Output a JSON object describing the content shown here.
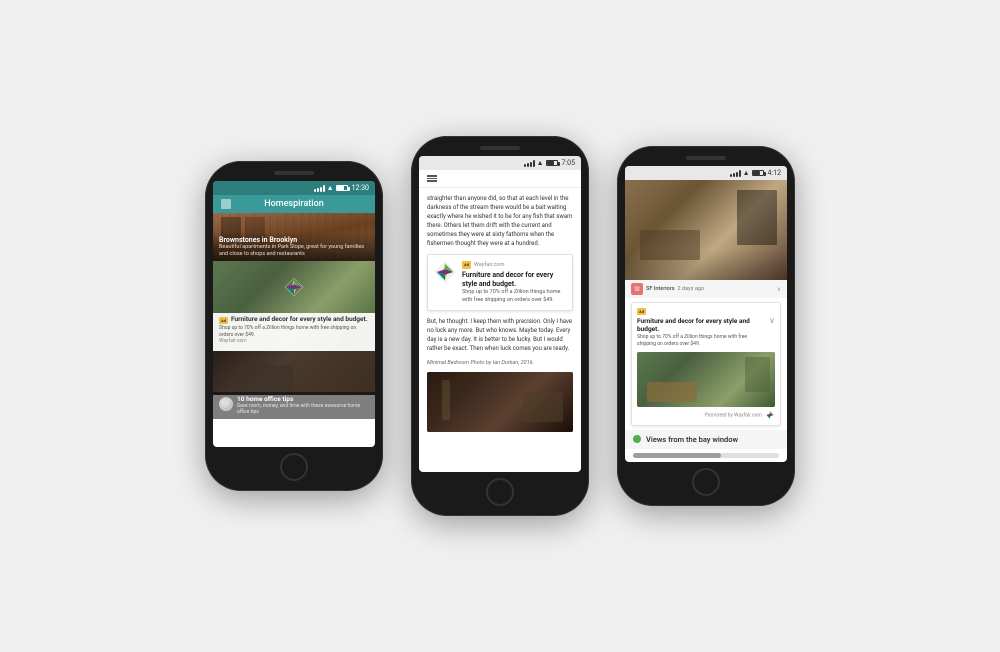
{
  "bg_color": "#f0f0f0",
  "phone1": {
    "status": {
      "time": "12:30",
      "carrier": ""
    },
    "header": {
      "title": "Homespiration",
      "home_icon": "🏠"
    },
    "card1": {
      "title": "Brownstones in Brooklyn",
      "subtitle": "Beautiful apartments in Park Slope, great for young families and close to shops and restaurants"
    },
    "card2": {
      "ad_label": "Ad",
      "source": "Wayfair.com",
      "title": "Furniture and decor for every style and budget.",
      "subtitle": "Shop up to 70% off a Zillion things home with free shipping on orders over $49."
    },
    "card3": {
      "title": "10 home office tips",
      "subtitle": "Save room, money, and time with these awesome home office tips"
    }
  },
  "phone2": {
    "status": {
      "time": "7:05"
    },
    "article_text": "straighter than anyone did, so that at each level in the darkness of the stream there would be a bait waiting exactly where he wished it to be for any fish that swam there. Others let them drift with the current and sometimes they were at sixty fathoms when the fishermen thought they were at a hundred.",
    "ad": {
      "ad_label": "Ad",
      "source": "Wayfair.com",
      "title": "Furniture and decor for every style and budget.",
      "subtitle": "Shop up to 70% off a Zillion things home with free shipping on orders over $49."
    },
    "article_text2": "But, he thought. I keep them with precision. Only I have no luck any more. But who knows. Maybe today. Every day is a new day. It is better to be lucky. But I would rather be exact. Then when luck comes you are ready.",
    "caption": "Minimal Bedroom",
    "caption_credit": "Photo by Ian Durkan, 2016."
  },
  "phone3": {
    "status": {
      "time": "4:12"
    },
    "source": {
      "name": "SF Interiors",
      "time": "2 days ago"
    },
    "ad": {
      "ad_label": "Ad",
      "title": "Furniture and decor for every style and budget.",
      "subtitle": "Shop up to 70% off a Zillion things home with free shipping on orders over $49.",
      "footer": "Promoted by Wayfair.com"
    },
    "bay_window": {
      "title": "Views from the bay window"
    },
    "nav": {
      "home": "⌂",
      "chat": "○",
      "star": "☆",
      "heart": "♡"
    }
  }
}
